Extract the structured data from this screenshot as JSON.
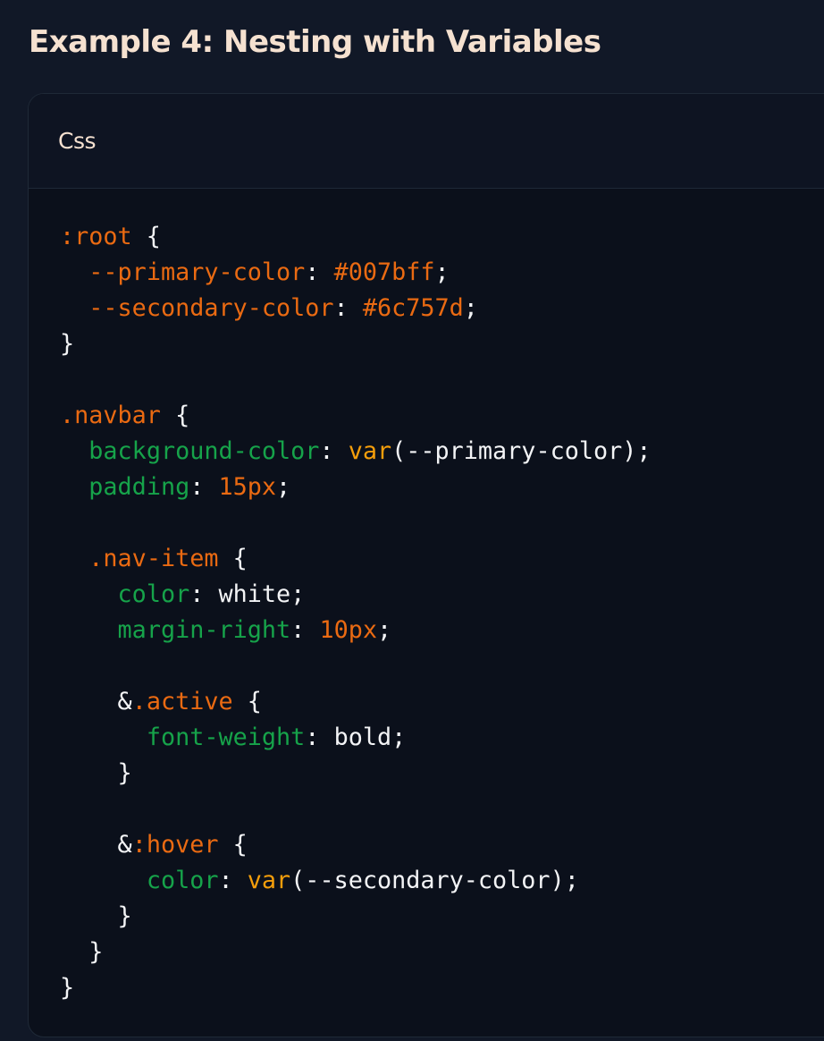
{
  "page": {
    "title": "Example 4: Nesting with Variables"
  },
  "code_block": {
    "language_label": "Css",
    "lines": [
      [
        {
          "t": ":root",
          "c": "selector"
        },
        {
          "t": " {",
          "c": "punct"
        }
      ],
      [
        {
          "t": "  ",
          "c": "plain"
        },
        {
          "t": "--primary-color",
          "c": "value"
        },
        {
          "t": ": ",
          "c": "punct"
        },
        {
          "t": "#007bff",
          "c": "value"
        },
        {
          "t": ";",
          "c": "punct"
        }
      ],
      [
        {
          "t": "  ",
          "c": "plain"
        },
        {
          "t": "--secondary-color",
          "c": "value"
        },
        {
          "t": ": ",
          "c": "punct"
        },
        {
          "t": "#6c757d",
          "c": "value"
        },
        {
          "t": ";",
          "c": "punct"
        }
      ],
      [
        {
          "t": "}",
          "c": "punct"
        }
      ],
      [],
      [
        {
          "t": ".navbar",
          "c": "selector"
        },
        {
          "t": " {",
          "c": "punct"
        }
      ],
      [
        {
          "t": "  ",
          "c": "plain"
        },
        {
          "t": "background-color",
          "c": "property"
        },
        {
          "t": ": ",
          "c": "punct"
        },
        {
          "t": "var",
          "c": "keyword"
        },
        {
          "t": "(--primary-color);",
          "c": "plain"
        }
      ],
      [
        {
          "t": "  ",
          "c": "plain"
        },
        {
          "t": "padding",
          "c": "property"
        },
        {
          "t": ": ",
          "c": "punct"
        },
        {
          "t": "15px",
          "c": "value"
        },
        {
          "t": ";",
          "c": "punct"
        }
      ],
      [],
      [
        {
          "t": "  ",
          "c": "plain"
        },
        {
          "t": ".nav-item",
          "c": "selector"
        },
        {
          "t": " {",
          "c": "punct"
        }
      ],
      [
        {
          "t": "    ",
          "c": "plain"
        },
        {
          "t": "color",
          "c": "property"
        },
        {
          "t": ": ",
          "c": "punct"
        },
        {
          "t": "white;",
          "c": "plain"
        }
      ],
      [
        {
          "t": "    ",
          "c": "plain"
        },
        {
          "t": "margin-right",
          "c": "property"
        },
        {
          "t": ": ",
          "c": "punct"
        },
        {
          "t": "10px",
          "c": "value"
        },
        {
          "t": ";",
          "c": "punct"
        }
      ],
      [],
      [
        {
          "t": "    ",
          "c": "plain"
        },
        {
          "t": "&",
          "c": "plain"
        },
        {
          "t": ".active",
          "c": "selector"
        },
        {
          "t": " {",
          "c": "punct"
        }
      ],
      [
        {
          "t": "      ",
          "c": "plain"
        },
        {
          "t": "font-weight",
          "c": "property"
        },
        {
          "t": ": ",
          "c": "punct"
        },
        {
          "t": "bold;",
          "c": "plain"
        }
      ],
      [
        {
          "t": "    }",
          "c": "punct"
        }
      ],
      [],
      [
        {
          "t": "    ",
          "c": "plain"
        },
        {
          "t": "&",
          "c": "plain"
        },
        {
          "t": ":hover",
          "c": "selector"
        },
        {
          "t": " {",
          "c": "punct"
        }
      ],
      [
        {
          "t": "      ",
          "c": "plain"
        },
        {
          "t": "color",
          "c": "property"
        },
        {
          "t": ": ",
          "c": "punct"
        },
        {
          "t": "var",
          "c": "keyword"
        },
        {
          "t": "(--secondary-color);",
          "c": "plain"
        }
      ],
      [
        {
          "t": "    }",
          "c": "punct"
        }
      ],
      [
        {
          "t": "  }",
          "c": "punct"
        }
      ],
      [
        {
          "t": "}",
          "c": "punct"
        }
      ]
    ]
  },
  "colors": {
    "background": "#111827",
    "code_background": "#0b101b",
    "title": "#f5e1d0",
    "selector_and_value": "#ea6a12",
    "property": "#16a34a",
    "keyword": "#f59e0b",
    "text": "#f3f4f6"
  }
}
